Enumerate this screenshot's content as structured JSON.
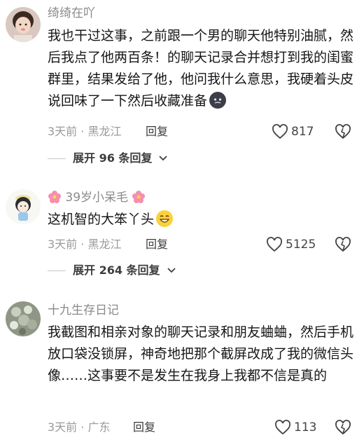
{
  "comments": [
    {
      "username": "绮绮在吖",
      "text": "我也干过这事，之前跟一个男的聊天他特别油腻，然后我点了他两百条！的聊天记录合并想打到我的闺蜜群里，结果发给了他，他问我什么意思，我硬着头皮说回味了一下然后收藏准备",
      "emoji": "dark-face-emoji",
      "meta": "3天前 · 黑龙江",
      "reply_label": "回复",
      "likes": "817",
      "expand_label": "展开 96 条回复"
    },
    {
      "username": "39岁小呆毛",
      "text": "这机智的大笨丫头",
      "emoji": "grin-emoji",
      "meta": "3天前 · 黑龙江",
      "reply_label": "回复",
      "likes": "5125",
      "expand_label": "展开 264 条回复"
    },
    {
      "username": "十九生存日记",
      "text": "我截图和相亲对象的聊天记录和朋友蛐蛐，然后手机放口袋没锁屏，神奇地把那个截屏改成了我的微信头像……这事要不是发生在我身上我都不信是真的",
      "meta": "3天前 · 广东",
      "reply_label": "回复",
      "likes": "113"
    }
  ],
  "colors": {
    "muted": "#9a9a9a",
    "text": "#161616",
    "flower": "#f48fb1"
  }
}
